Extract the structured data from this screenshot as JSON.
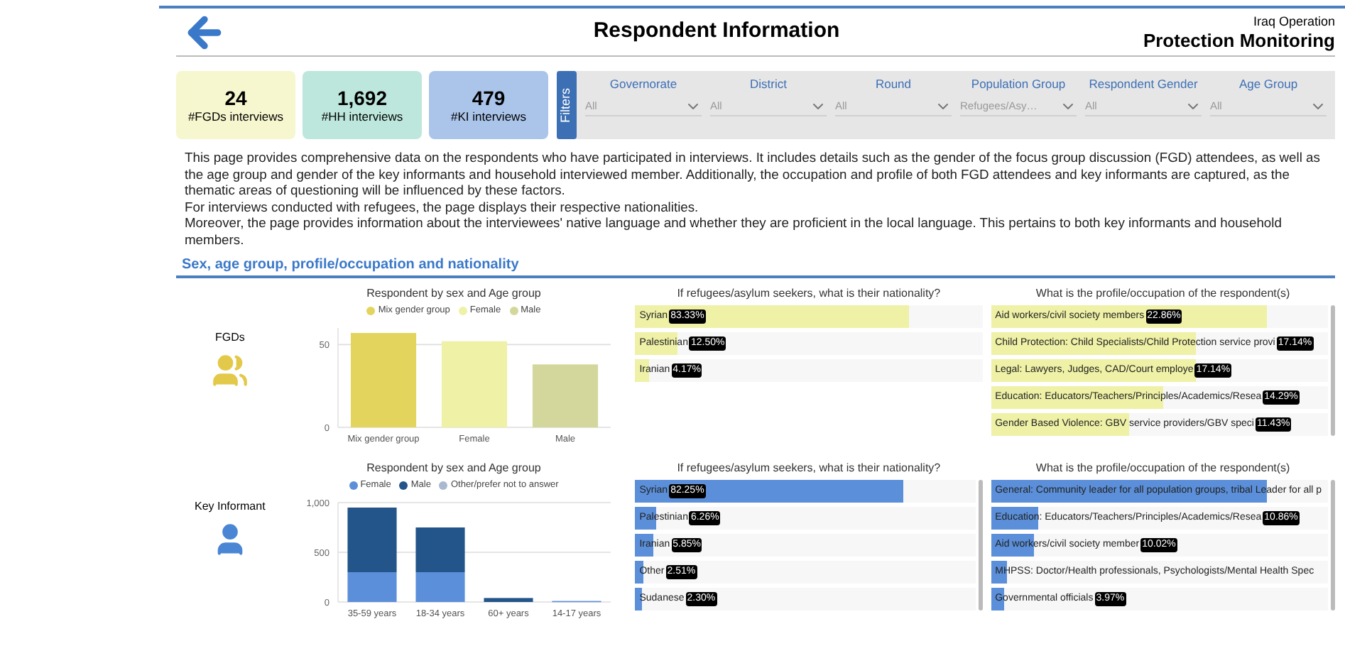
{
  "header": {
    "title": "Respondent Information",
    "org": "Iraq Operation",
    "subtitle": "Protection Monitoring"
  },
  "stats": [
    {
      "value": "24",
      "label": "#FGDs interviews",
      "color": "#f6f6cf"
    },
    {
      "value": "1,692",
      "label": "#HH interviews",
      "color": "#bde7dc"
    },
    {
      "value": "479",
      "label": "#KI interviews",
      "color": "#aac4ea"
    }
  ],
  "filters": {
    "tab": "Filters",
    "items": [
      {
        "label": "Governorate",
        "value": "All"
      },
      {
        "label": "District",
        "value": "All"
      },
      {
        "label": "Round",
        "value": "All"
      },
      {
        "label": "Population Group",
        "value": "Refugees/Asy…"
      },
      {
        "label": "Respondent Gender",
        "value": "All"
      },
      {
        "label": "Age Group",
        "value": "All"
      }
    ]
  },
  "description": [
    "This page provides comprehensive data on the respondents who have participated in interviews. It includes details such as the gender of the focus group discussion (FGD) attendees, as well as the age group and gender of the key informants and household interviewed member. Additionally, the occupation and profile of both FGD attendees and key informants are captured, as the thematic areas of questioning will be influenced by these factors.",
    "For interviews conducted with refugees, the page displays their respective nationalities.",
    "Moreover, the page provides information about the interviewees' native language and whether they are proficient in the local language. This pertains to both key informants and household members."
  ],
  "section_title": "Sex, age group, profile/occupation and nationality",
  "rows": [
    {
      "kind": "fgd",
      "group": "FGDs",
      "chart_data": {
        "type": "bar",
        "title": "Respondent by sex and Age group",
        "categories": [
          "Mix gender group",
          "Female",
          "Male"
        ],
        "series": [
          {
            "name": "Mix gender group",
            "color": "#e3d45e",
            "values": [
              57,
              null,
              null
            ]
          },
          {
            "name": "Female",
            "color": "#eef1a6",
            "values": [
              null,
              52,
              null
            ]
          },
          {
            "name": "Male",
            "color": "#d4d79b",
            "values": [
              null,
              null,
              38
            ]
          }
        ],
        "ylim": [
          0,
          60
        ],
        "yticks": [
          0,
          50
        ],
        "legend": "top"
      },
      "nationality": {
        "title": "If refugees/asylum seekers, what is their nationality?",
        "items": [
          {
            "label": "Syrian",
            "value": "83.33%",
            "level": 0.79
          },
          {
            "label": "Palestinian",
            "value": "12.50%",
            "level": 0.12
          },
          {
            "label": "Iranian",
            "value": "4.17%",
            "level": 0.04
          }
        ]
      },
      "profile": {
        "title": "What is the profile/occupation of the respondent(s)",
        "items": [
          {
            "label": "Aid workers/civil society members",
            "value": "22.86%",
            "level": 0.82
          },
          {
            "label": "Child Protection: Child Specialists/Child Protection service provi",
            "value": "17.14%",
            "level": 0.61
          },
          {
            "label": "Legal: Lawyers, Judges, CAD/Court employe",
            "value": "17.14%",
            "level": 0.61
          },
          {
            "label": "Education: Educators/Teachers/Principles/Academics/Resea",
            "value": "14.29%",
            "level": 0.51
          },
          {
            "label": "Gender Based Violence: GBV service providers/GBV speci",
            "value": "11.43%",
            "level": 0.41
          }
        ]
      }
    },
    {
      "kind": "ki",
      "group": "Key Informant",
      "chart_data": {
        "type": "bar",
        "title": "Respondent by sex and Age group",
        "stacked": true,
        "categories": [
          "35-59 years",
          "18-34 years",
          "60+ years",
          "14-17 years"
        ],
        "series": [
          {
            "name": "Female",
            "color": "#5b8fd9",
            "values": [
              300,
              300,
              null,
              10
            ]
          },
          {
            "name": "Male",
            "color": "#23548a",
            "values": [
              650,
              450,
              40,
              null
            ]
          },
          {
            "name": "Other/prefer not to answer",
            "color": "#a9b9cf",
            "values": [
              null,
              null,
              null,
              null
            ]
          }
        ],
        "ylim": [
          0,
          1000
        ],
        "yticks": [
          0,
          500,
          {
            "value": 1000,
            "label": "1,000"
          }
        ],
        "legend": "top"
      },
      "nationality": {
        "title": "If refugees/asylum seekers, what is their nationality?",
        "items": [
          {
            "label": "Syrian",
            "value": "82.25%",
            "level": 0.79
          },
          {
            "label": "Palestinian",
            "value": "6.26%",
            "level": 0.06
          },
          {
            "label": "Iranian",
            "value": "5.85%",
            "level": 0.055
          },
          {
            "label": "Other",
            "value": "2.51%",
            "level": 0.025
          },
          {
            "label": "Sudanese",
            "value": "2.30%",
            "level": 0.022
          }
        ]
      },
      "profile": {
        "title": "What is the profile/occupation of the respondent(s)",
        "items": [
          {
            "label": "General: Community leader for all population groups, tribal Leader for all p",
            "level": 0.82
          },
          {
            "label": "Education: Educators/Teachers/Principles/Academics/Resea",
            "value": "10.86%",
            "level": 0.14
          },
          {
            "label": "Aid workers/civil society member",
            "value": "10.02%",
            "level": 0.13
          },
          {
            "label": "MHPSS: Doctor/Health professionals, Psychologists/Mental Health Spec",
            "level": 0.05
          },
          {
            "label": "Governmental officials",
            "value": "3.97%",
            "level": 0.04
          }
        ]
      }
    }
  ]
}
